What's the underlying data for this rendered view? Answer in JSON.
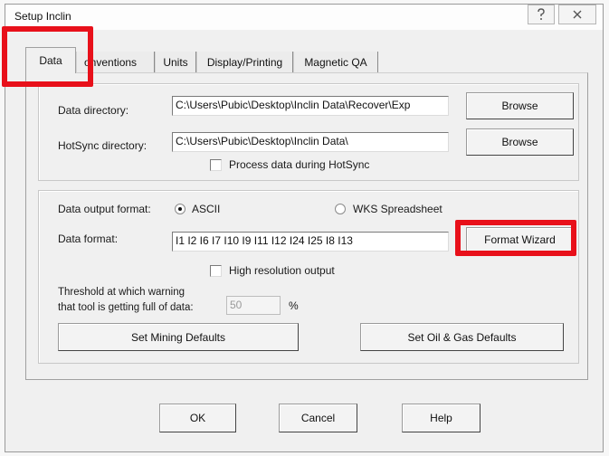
{
  "window": {
    "title": "Setup Inclin",
    "help_icon": "question-mark-icon",
    "close_icon": "close-icon"
  },
  "tabs": [
    {
      "label": "Data",
      "active": true
    },
    {
      "label": "onventions",
      "active": false
    },
    {
      "label": "Units",
      "active": false
    },
    {
      "label": "Display/Printing",
      "active": false
    },
    {
      "label": "Magnetic QA",
      "active": false
    }
  ],
  "directories": {
    "data_label": "Data directory:",
    "data_value": "C:\\Users\\Pubic\\Desktop\\Inclin Data\\Recover\\Exp",
    "data_browse": "Browse",
    "hotsync_label": "HotSync directory:",
    "hotsync_value": "C:\\Users\\Pubic\\Desktop\\Inclin Data\\",
    "hotsync_browse": "Browse",
    "process_hotsync_label": "Process data during HotSync",
    "process_hotsync_checked": false
  },
  "output": {
    "format_label": "Data output format:",
    "ascii_label": "ASCII",
    "ascii_selected": true,
    "wks_label": "WKS Spreadsheet",
    "wks_selected": false,
    "data_format_label": "Data format:",
    "data_format_value": "I1 I2 I6 I7 I10 I9 I11 I12 I24 I25 I8 I13",
    "format_wizard": "Format Wizard",
    "high_res_label": "High resolution output",
    "high_res_checked": false,
    "threshold_label_line1": "Threshold at which warning",
    "threshold_label_line2": "that tool is getting full of data:",
    "threshold_value": "50",
    "threshold_unit": "%",
    "mining_defaults": "Set Mining Defaults",
    "oil_gas_defaults": "Set Oil & Gas Defaults"
  },
  "footer": {
    "ok": "OK",
    "cancel": "Cancel",
    "help": "Help"
  },
  "colors": {
    "highlight": "#e8101a",
    "dialog_bg": "#f0f0f0"
  }
}
